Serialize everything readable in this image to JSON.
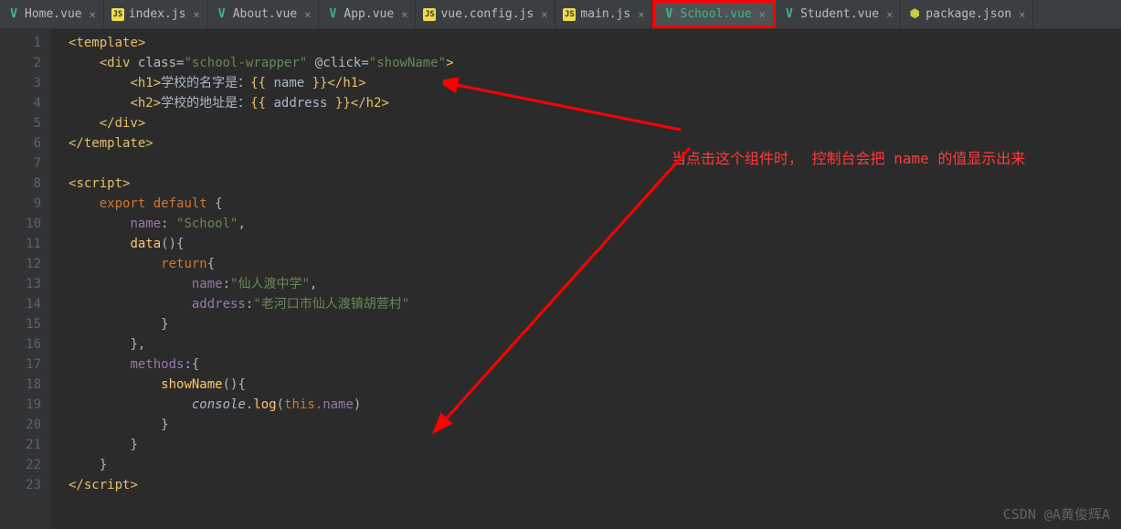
{
  "tabs": [
    {
      "label": "Home.vue",
      "icon": "vue"
    },
    {
      "label": "index.js",
      "icon": "js"
    },
    {
      "label": "About.vue",
      "icon": "vue"
    },
    {
      "label": "App.vue",
      "icon": "vue"
    },
    {
      "label": "vue.config.js",
      "icon": "js"
    },
    {
      "label": "main.js",
      "icon": "js"
    },
    {
      "label": "School.vue",
      "icon": "vue"
    },
    {
      "label": "Student.vue",
      "icon": "vue"
    },
    {
      "label": "package.json",
      "icon": "json"
    }
  ],
  "lines": [
    "1",
    "2",
    "3",
    "4",
    "5",
    "6",
    "7",
    "8",
    "9",
    "10",
    "11",
    "12",
    "13",
    "14",
    "15",
    "16",
    "17",
    "18",
    "19",
    "20",
    "21",
    "22",
    "23"
  ],
  "code": {
    "tpl_open": "template",
    "div": "div",
    "class_attr": "class",
    "class_val": "\"school-wrapper\"",
    "click_attr": "@click",
    "click_val": "\"showName\"",
    "h1": "h1",
    "h2": "h2",
    "h1_text": "学校的名字是：",
    "h2_text": "学校的地址是：",
    "interp_open": "{{ ",
    "interp_close": " }}",
    "var_name": "name",
    "var_addr": "address",
    "script_tag": "script",
    "export": "export ",
    "default": "default ",
    "brace_o": "{",
    "brace_c": "}",
    "name_key": "name",
    "name_val": "\"School\"",
    "data_fn": "data",
    "return": "return",
    "data_name_key": "name",
    "data_name_val": "\"仙人渡中学\"",
    "addr_key": "address",
    "addr_val": "\"老河口市仙人渡镇胡营村\"",
    "methods": "methods",
    "showName": "showName",
    "console": "console",
    "log": "log",
    "this": "this",
    "dot_name": ".name"
  },
  "annotation": "当点击这个组件时，  控制台会把 name 的值显示出来",
  "watermark": "CSDN @A黄俊辉A"
}
